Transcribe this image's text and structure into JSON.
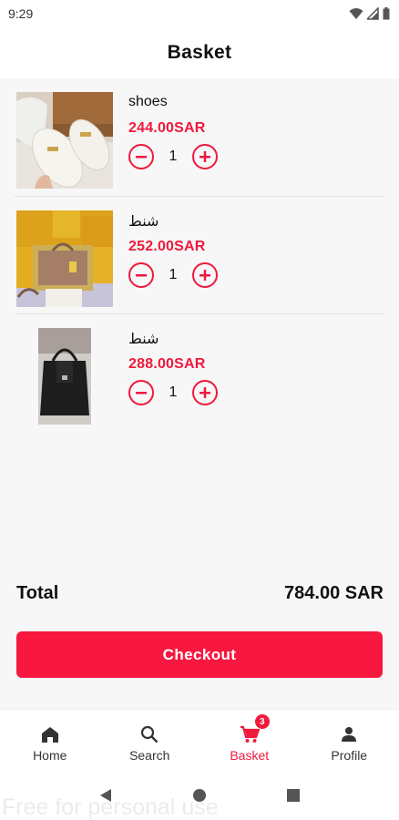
{
  "status_bar": {
    "time": "9:29"
  },
  "app_bar": {
    "title": "Basket"
  },
  "basket": {
    "items": [
      {
        "name": "shoes",
        "price": "244.00SAR",
        "quantity": "1"
      },
      {
        "name": "شنط",
        "price": "252.00SAR",
        "quantity": "1"
      },
      {
        "name": "شنط",
        "price": "288.00SAR",
        "quantity": "1"
      }
    ]
  },
  "summary": {
    "total_label": "Total",
    "total_value": "784.00 SAR"
  },
  "checkout": {
    "label": "Checkout"
  },
  "bottom_nav": {
    "items": [
      {
        "label": "Home",
        "icon": "home-icon",
        "active": false
      },
      {
        "label": "Search",
        "icon": "search-icon",
        "active": false
      },
      {
        "label": "Basket",
        "icon": "cart-icon",
        "active": true,
        "badge": "3"
      },
      {
        "label": "Profile",
        "icon": "person-icon",
        "active": false
      }
    ]
  },
  "watermark": "Free for personal use",
  "colors": {
    "accent": "#f0193c",
    "button": "#f7173f",
    "background": "#f7f7f7"
  }
}
